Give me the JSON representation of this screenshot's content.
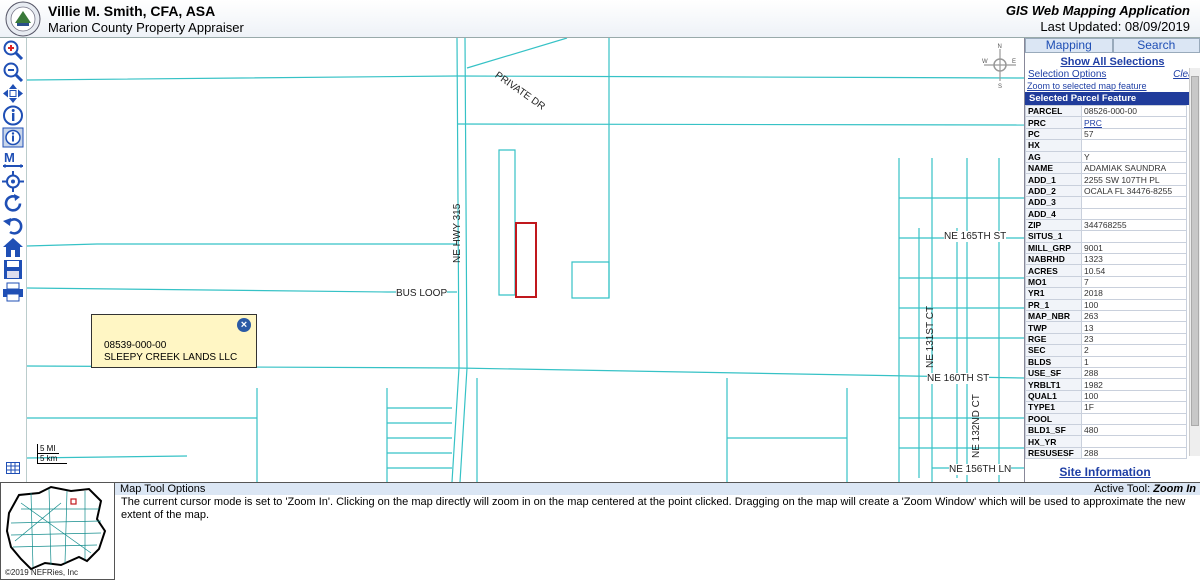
{
  "header": {
    "org_name": "Villie M. Smith, CFA, ASA",
    "org_sub": "Marion County Property Appraiser",
    "app_title": "GIS Web Mapping Application",
    "app_updated": "Last Updated: 08/09/2019"
  },
  "toolbar": {
    "tools": [
      "zoom-in-icon",
      "zoom-out-icon",
      "pan-icon",
      "identify-icon",
      "info-icon",
      "measure-icon",
      "locate-icon",
      "refresh-icon",
      "back-icon",
      "home-icon",
      "save-icon",
      "print-icon"
    ]
  },
  "map": {
    "roads": {
      "private_dr": "PRIVATE DR",
      "ne_hwy_315": "NE HWY 315",
      "bus_loop": "BUS LOOP",
      "ne_165th": "NE 165TH ST",
      "ne_160th": "NE 160TH ST",
      "ne_131st": "NE 131ST CT",
      "ne_132nd": "NE 132ND CT",
      "ne_156th": "NE 156TH LN"
    },
    "popup": {
      "parcel": "08539-000-00",
      "owner": "SLEEPY CREEK LANDS LLC",
      "close": "×"
    },
    "compass": {
      "n": "N",
      "s": "S",
      "e": "E",
      "w": "W"
    },
    "scale": {
      "mi": "5 MI",
      "km": "5 km"
    },
    "colors": {
      "lines": "#36c2c6",
      "selected": "#c0181d"
    }
  },
  "panel": {
    "tabs": [
      "Mapping",
      "Search"
    ],
    "show_all": "Show All Selections",
    "selection_options": "Selection Options",
    "clear": "Clear",
    "zoom_link": "Zoom to selected map feature",
    "feature_head": "Selected Parcel Feature",
    "attributes": [
      {
        "k": "PARCEL",
        "v": "08526-000-00"
      },
      {
        "k": "PRC",
        "v": "PRC"
      },
      {
        "k": "PC",
        "v": "57"
      },
      {
        "k": "HX",
        "v": ""
      },
      {
        "k": "AG",
        "v": "Y"
      },
      {
        "k": "NAME",
        "v": "ADAMIAK SAUNDRA"
      },
      {
        "k": "ADD_1",
        "v": "2255 SW 107TH PL"
      },
      {
        "k": "ADD_2",
        "v": "OCALA FL 34476-8255"
      },
      {
        "k": "ADD_3",
        "v": ""
      },
      {
        "k": "ADD_4",
        "v": ""
      },
      {
        "k": "ZIP",
        "v": "344768255"
      },
      {
        "k": "SITUS_1",
        "v": ""
      },
      {
        "k": "MILL_GRP",
        "v": "9001"
      },
      {
        "k": "NABRHD",
        "v": "1323"
      },
      {
        "k": "ACRES",
        "v": "10.54"
      },
      {
        "k": "MO1",
        "v": "7"
      },
      {
        "k": "YR1",
        "v": "2018"
      },
      {
        "k": "PR_1",
        "v": "100"
      },
      {
        "k": "MAP_NBR",
        "v": "263"
      },
      {
        "k": "TWP",
        "v": "13"
      },
      {
        "k": "RGE",
        "v": "23"
      },
      {
        "k": "SEC",
        "v": "2"
      },
      {
        "k": "BLDS",
        "v": "1"
      },
      {
        "k": "USE_SF",
        "v": "288"
      },
      {
        "k": "YRBLT1",
        "v": "1982"
      },
      {
        "k": "QUAL1",
        "v": "100"
      },
      {
        "k": "TYPE1",
        "v": "1F"
      },
      {
        "k": "POOL",
        "v": ""
      },
      {
        "k": "BLD1_SF",
        "v": "480"
      },
      {
        "k": "HX_YR",
        "v": ""
      },
      {
        "k": "RESUSESF",
        "v": "288"
      }
    ],
    "site_info": "Site Information"
  },
  "options": {
    "title": "Map Tool Options",
    "active_tool_label": "Active Tool:",
    "active_tool_value": "Zoom In",
    "text": "The current cursor mode is set to 'Zoom In'. Clicking on the map directly will zoom in on the map centered at the point clicked. Dragging on the map will create a 'Zoom Window' which will be used to approximate the new extent of the map."
  },
  "overview": {
    "copyright": "©2019 NEFRies, Inc"
  }
}
